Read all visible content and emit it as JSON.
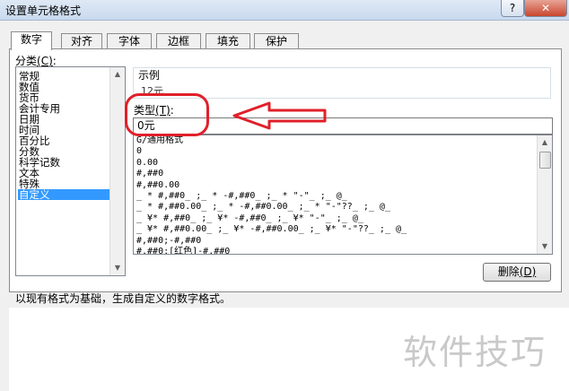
{
  "window": {
    "title": "设置单元格格式",
    "help_label": "?",
    "close_label": "✕"
  },
  "tabs": [
    {
      "label": "数字",
      "active": true
    },
    {
      "label": "对齐"
    },
    {
      "label": "字体"
    },
    {
      "label": "边框"
    },
    {
      "label": "填充"
    },
    {
      "label": "保护"
    }
  ],
  "category": {
    "label_text": "分类",
    "label_key": "(C)",
    "label_colon": ":",
    "items": [
      "常规",
      "数值",
      "货币",
      "会计专用",
      "日期",
      "时间",
      "百分比",
      "分数",
      "科学记数",
      "文本",
      "特殊",
      "自定义"
    ],
    "selected_index": 11
  },
  "sample": {
    "caption": "示例",
    "value": "12元"
  },
  "type_field": {
    "label_text": "类型",
    "label_key": "(T)",
    "label_colon": ":",
    "value": "0元"
  },
  "format_list": [
    "G/通用格式",
    "0",
    "0.00",
    "#,##0",
    "#,##0.00",
    "_ * #,##0_ ;_ * -#,##0_ ;_ * \"-\"_ ;_ @_",
    "_ * #,##0.00_ ;_ * -#,##0.00_ ;_ * \"-\"??_ ;_ @_",
    "_ ¥* #,##0_ ;_ ¥* -#,##0_ ;_ ¥* \"-\"_ ;_ @_",
    "_ ¥* #,##0.00_ ;_ ¥* -#,##0.00_ ;_ ¥* \"-\"??_ ;_ @_",
    "#,##0;-#,##0",
    "#,##0;[红色]-#,##0"
  ],
  "buttons": {
    "delete_text": "删除",
    "delete_key": "(D)"
  },
  "hint": "以现有格式为基础，生成自定义的数字格式。",
  "watermark": "软件技巧",
  "colors": {
    "selection": "#3399ff",
    "annotation": "#e0202a",
    "watermark": "#c9c9c9"
  }
}
